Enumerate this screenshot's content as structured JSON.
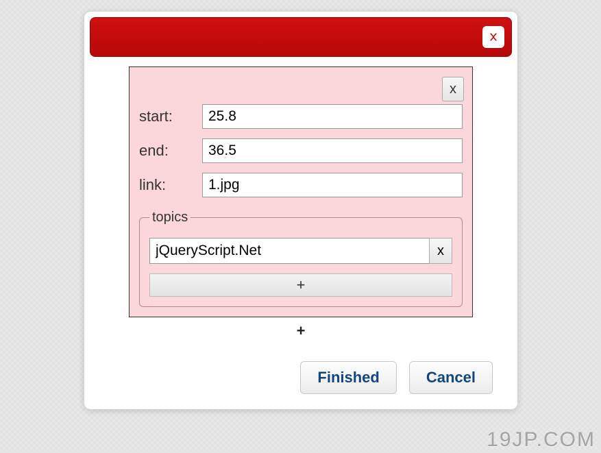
{
  "header": {
    "title": ""
  },
  "group": {
    "remove_label": "x",
    "fields": {
      "start": {
        "label": "start:",
        "value": "25.8"
      },
      "end": {
        "label": "end:",
        "value": "36.5"
      },
      "link": {
        "label": "link:",
        "value": "1.jpg"
      }
    },
    "topics": {
      "legend": "topics",
      "items": [
        {
          "value": "jQueryScript.Net",
          "remove_label": "x"
        }
      ],
      "add_label": "+"
    }
  },
  "add_group_label": "+",
  "buttons": {
    "finished": "Finished",
    "cancel": "Cancel"
  },
  "watermark": "19JP.COM"
}
